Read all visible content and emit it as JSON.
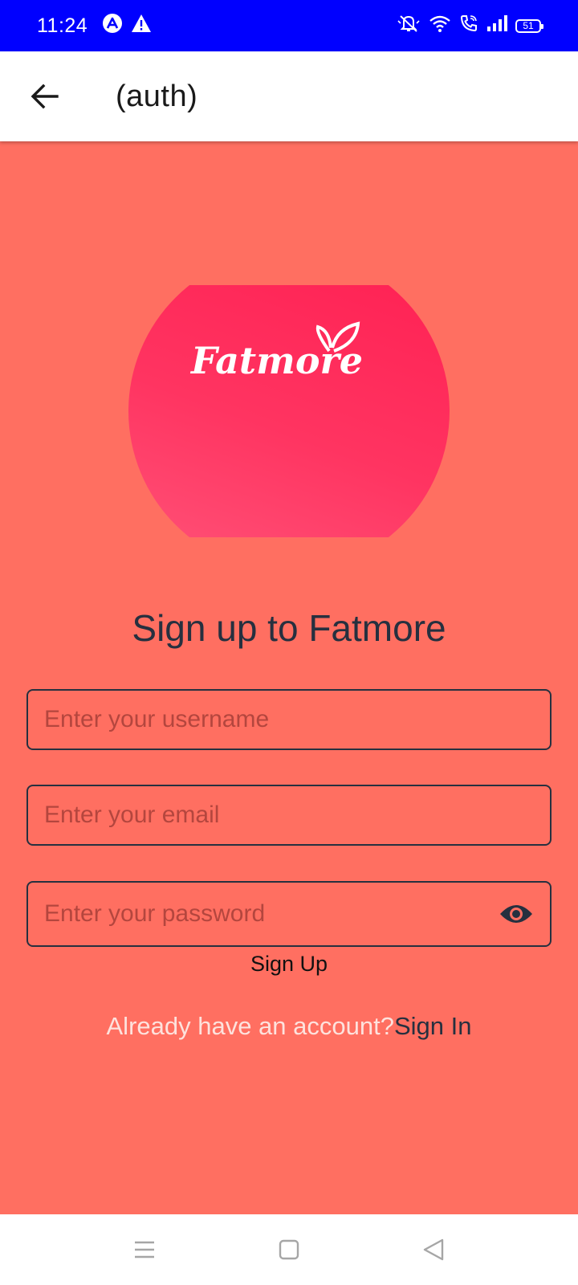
{
  "status_bar": {
    "time": "11:24",
    "battery": "51",
    "icons": [
      "app-icon",
      "warning-icon",
      "mute-icon",
      "wifi-icon",
      "wifi-call-icon",
      "signal-icon",
      "battery-icon"
    ]
  },
  "app_bar": {
    "title": "(auth)",
    "back_icon": "arrow-left-icon"
  },
  "logo": {
    "text": "Fatmore",
    "colors": {
      "circle_top": "#ff1f52",
      "circle_bottom": "#ff5479",
      "text": "#ffffff"
    }
  },
  "form": {
    "heading": "Sign up to Fatmore",
    "username_placeholder": "Enter your username",
    "email_placeholder": "Enter your email",
    "password_placeholder": "Enter your password",
    "password_toggle_icon": "eye-icon",
    "submit_label": "Sign Up"
  },
  "signin": {
    "prompt": "Already have an account?",
    "link": "Sign In"
  },
  "nav_bar": {
    "icons": [
      "menu-icon",
      "home-square-icon",
      "back-triangle-icon"
    ]
  },
  "colors": {
    "background": "#ff6f61",
    "status_bar": "#0000ff",
    "text_dark": "#26303f",
    "placeholder": "#b4463e",
    "muted_text": "#fde2dd"
  }
}
